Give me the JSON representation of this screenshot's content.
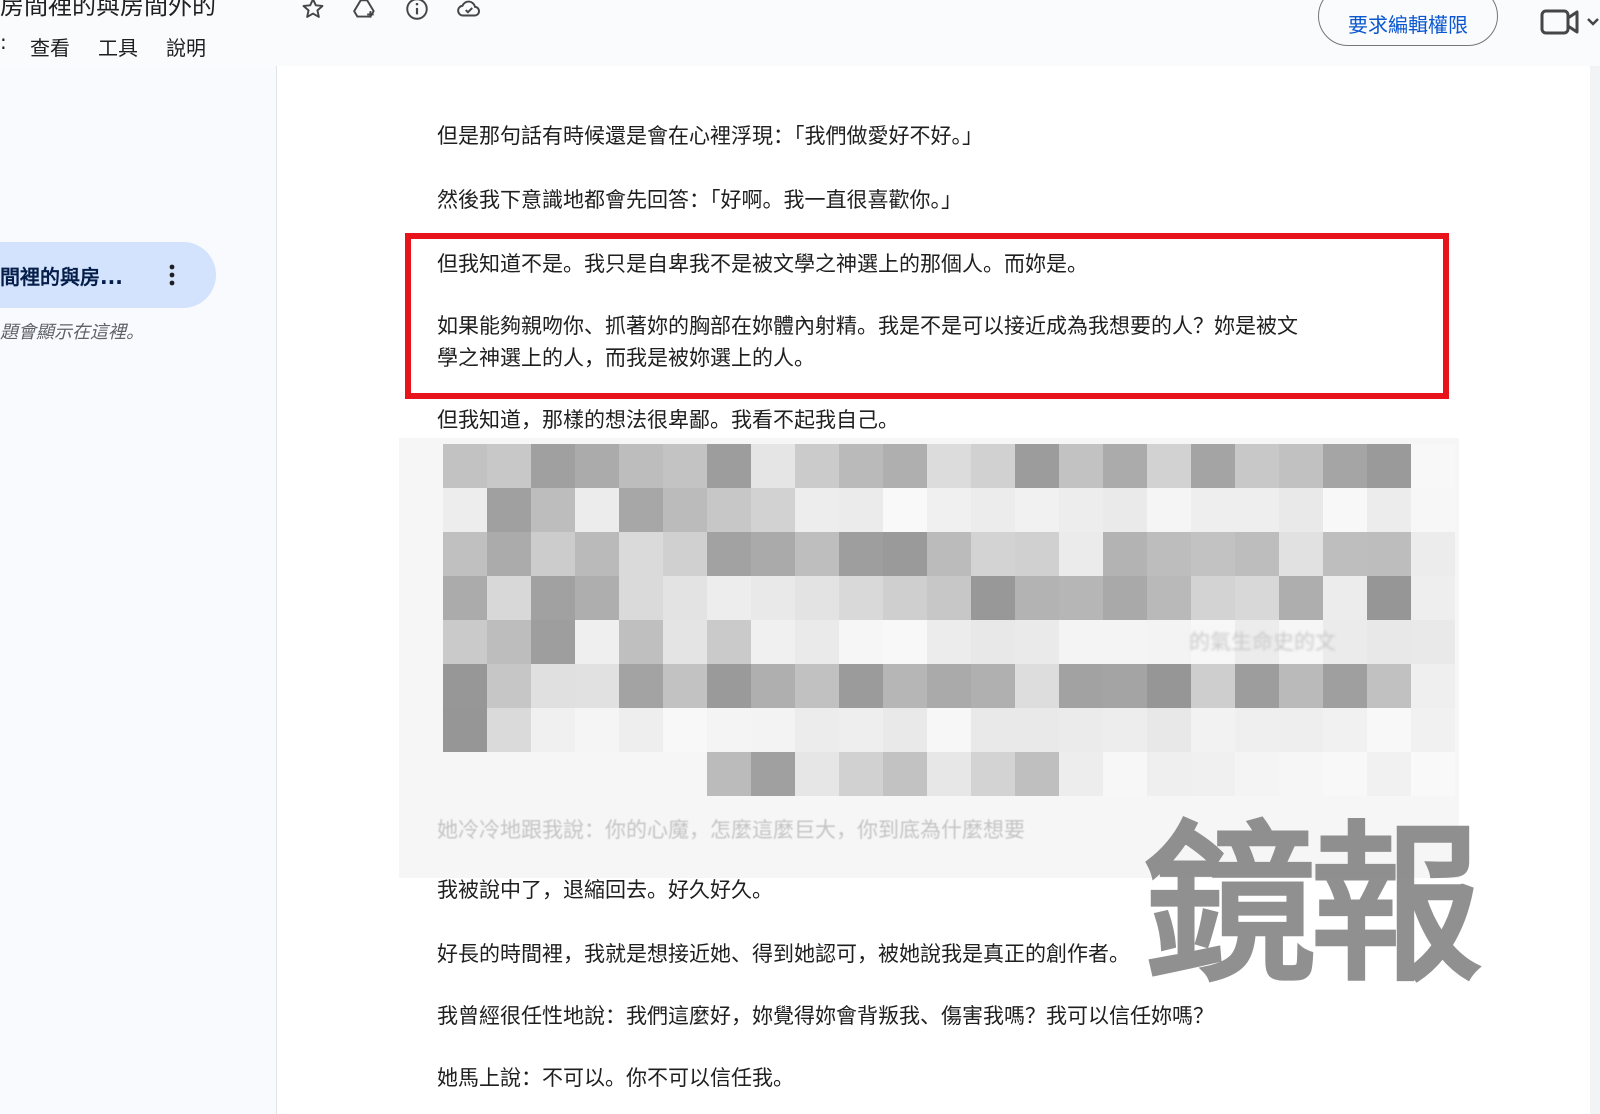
{
  "header": {
    "doc_title": "房間裡的與房間外的",
    "menu": [
      "查看",
      "工具",
      "說明"
    ],
    "request_edit_label": "要求編輯權限",
    "icons": [
      "star-icon",
      "move-to-drive-icon",
      "info-icon",
      "cloud-status-icon",
      "video-call-icon"
    ]
  },
  "outline": {
    "item_label": "間裡的與房...",
    "hint": "題會顯示在這裡。"
  },
  "document": {
    "paragraphs": [
      "但是那句話有時候還是會在心裡浮現：「我們做愛好不好。」",
      "然後我下意識地都會先回答：「好啊。我一直很喜歡你。」",
      "但我知道不是。我只是自卑我不是被文學之神選上的那個人。而妳是。",
      "如果能夠親吻你、抓著妳的胸部在妳體內射精。我是不是可以接近成為我想要的人？妳是被文",
      "學之神選上的人，而我是被妳選上的人。",
      "但我知道，那樣的想法很卑鄙。我看不起我自己。",
      "她冷冷地跟我說：你的心魔，怎麼這麼巨大，你到底為什麼想要",
      "我被說中了，退縮回去。好久好久。",
      "好長的時間裡，我就是想接近她、得到她認可，被她說我是真正的創作者。",
      "我曾經很任性地說：我們這麼好，妳覺得妳會背叛我、傷害我嗎？我可以信任妳嗎？",
      "她馬上說：不可以。你不可以信任我。"
    ],
    "blurred_fragment": "的氣生命史的文"
  },
  "watermark": "鏡報",
  "colors": {
    "highlight_box": "#e8141b",
    "request_button_text": "#0b57d0",
    "outline_selected": "#d3e3fd"
  }
}
